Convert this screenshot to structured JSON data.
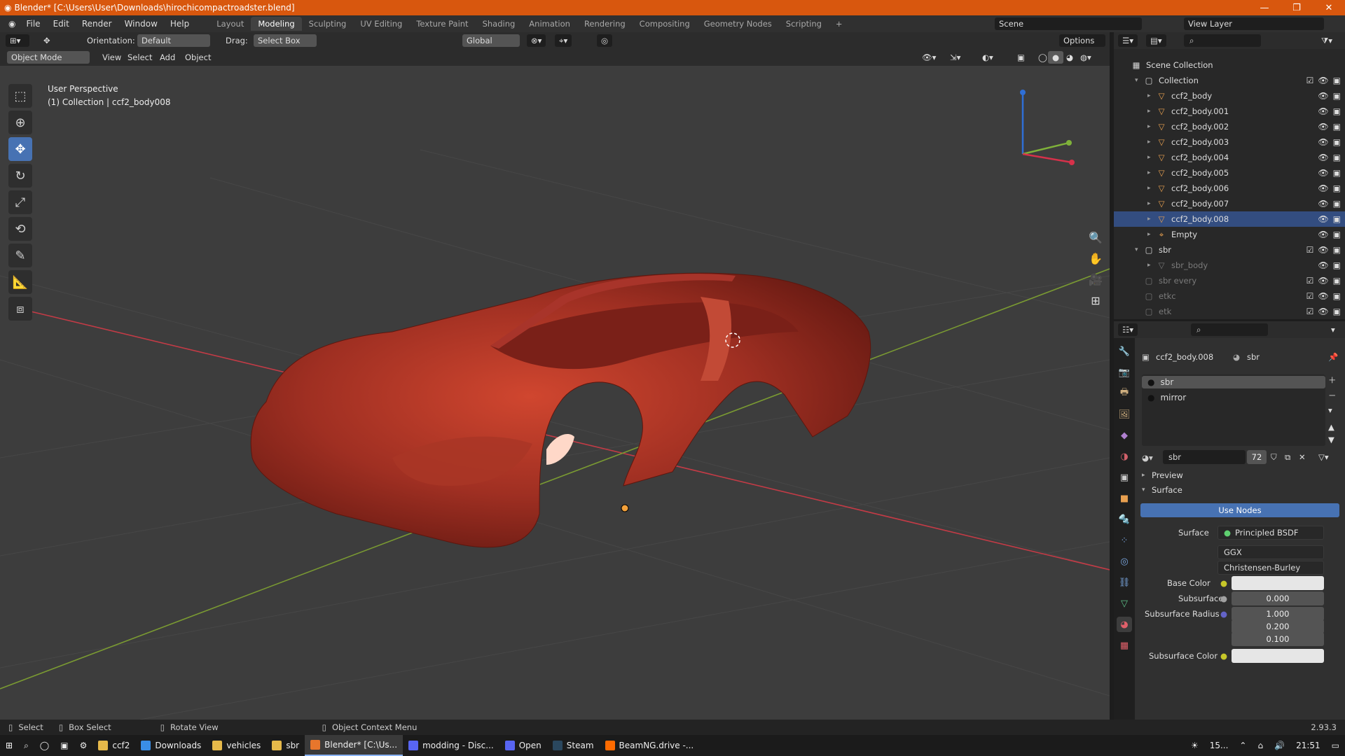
{
  "window": {
    "title": "Blender* [C:\\Users\\User\\Downloads\\hirochicompactroadster.blend]",
    "minimize": "—",
    "restore": "❐",
    "close": "✕"
  },
  "menu": {
    "items": [
      "File",
      "Edit",
      "Render",
      "Window",
      "Help"
    ]
  },
  "workspaces": {
    "tabs": [
      "Layout",
      "Modeling",
      "Sculpting",
      "UV Editing",
      "Texture Paint",
      "Shading",
      "Animation",
      "Rendering",
      "Compositing",
      "Geometry Nodes",
      "Scripting"
    ],
    "active": "Modeling",
    "add": "+"
  },
  "scene": {
    "name": "Scene",
    "view_layer": "View Layer"
  },
  "header": {
    "orientation_label": "Orientation:",
    "orientation_value": "Default",
    "drag_label": "Drag:",
    "drag_value": "Select Box",
    "transform_space": "Global",
    "options": "Options",
    "mode": "Object Mode",
    "menus": [
      "View",
      "Select",
      "Add",
      "Object"
    ]
  },
  "viewport": {
    "perspective": "User Perspective",
    "collection_info": "(1) Collection | ccf2_body008",
    "colors": {
      "bg": "#3d3d3d",
      "x_axis": "#c33b46",
      "y_axis": "#7a9a32",
      "body": "#b8382a"
    }
  },
  "outliner": {
    "search_placeholder": "",
    "root": "Scene Collection",
    "items": [
      {
        "label": "Collection",
        "type": "collection",
        "depth": 1,
        "expanded": true,
        "dim": false,
        "selected": false
      },
      {
        "label": "ccf2_body",
        "type": "mesh",
        "depth": 2,
        "dim": false,
        "selected": false
      },
      {
        "label": "ccf2_body.001",
        "type": "mesh",
        "depth": 2,
        "dim": false,
        "selected": false
      },
      {
        "label": "ccf2_body.002",
        "type": "mesh",
        "depth": 2,
        "dim": false,
        "selected": false
      },
      {
        "label": "ccf2_body.003",
        "type": "mesh",
        "depth": 2,
        "dim": false,
        "selected": false
      },
      {
        "label": "ccf2_body.004",
        "type": "mesh",
        "depth": 2,
        "dim": false,
        "selected": false
      },
      {
        "label": "ccf2_body.005",
        "type": "mesh",
        "depth": 2,
        "dim": false,
        "selected": false
      },
      {
        "label": "ccf2_body.006",
        "type": "mesh",
        "depth": 2,
        "dim": false,
        "selected": false
      },
      {
        "label": "ccf2_body.007",
        "type": "mesh",
        "depth": 2,
        "dim": false,
        "selected": false
      },
      {
        "label": "ccf2_body.008",
        "type": "mesh",
        "depth": 2,
        "dim": false,
        "selected": true
      },
      {
        "label": "Empty",
        "type": "empty",
        "depth": 2,
        "dim": false,
        "selected": false
      },
      {
        "label": "sbr",
        "type": "collection",
        "depth": 1,
        "expanded": true,
        "dim": false,
        "selected": false
      },
      {
        "label": "sbr_body",
        "type": "mesh",
        "depth": 2,
        "dim": true,
        "selected": false
      },
      {
        "label": "sbr every",
        "type": "collection",
        "depth": 1,
        "dim": true,
        "selected": false
      },
      {
        "label": "etkc",
        "type": "collection",
        "depth": 1,
        "dim": true,
        "selected": false
      },
      {
        "label": "etk",
        "type": "collection",
        "depth": 1,
        "dim": true,
        "selected": false
      }
    ]
  },
  "properties": {
    "breadcrumb_object": "ccf2_body.008",
    "breadcrumb_material": "sbr",
    "slots": [
      {
        "label": "sbr",
        "active": true
      },
      {
        "label": "mirror",
        "active": false
      }
    ],
    "material_name": "sbr",
    "user_count": "72",
    "preview_panel": "Preview",
    "surface_panel": "Surface",
    "use_nodes": "Use Nodes",
    "surface_label": "Surface",
    "surface_value": "Principled BSDF",
    "distribution": "GGX",
    "subsurface_method": "Christensen-Burley",
    "base_color_label": "Base Color",
    "subsurface_label": "Subsurface",
    "subsurface_value": "0.000",
    "subsurface_radius_label": "Subsurface Radius",
    "subsurface_radius": [
      "1.000",
      "0.200",
      "0.100"
    ],
    "subsurface_color_label": "Subsurface Color"
  },
  "status": {
    "select": "Select",
    "box_select": "Box Select",
    "rotate": "Rotate View",
    "context": "Object Context Menu",
    "version": "2.93.3"
  },
  "taskbar": {
    "items": [
      {
        "label": "ccf2",
        "color": "#e6b94a",
        "active": false
      },
      {
        "label": "Downloads",
        "color": "#3a8ee6",
        "active": false
      },
      {
        "label": "vehicles",
        "color": "#e6b94a",
        "active": false
      },
      {
        "label": "sbr",
        "color": "#e6b94a",
        "active": false
      },
      {
        "label": "Blender* [C:\\Us...",
        "color": "#e8762c",
        "active": true
      },
      {
        "label": "modding - Disc...",
        "color": "#5865f2",
        "active": false
      },
      {
        "label": "Open",
        "color": "#5865f2",
        "active": false
      },
      {
        "label": "Steam",
        "color": "#2a475e",
        "active": false
      },
      {
        "label": "BeamNG.drive -...",
        "color": "#ff6b00",
        "active": false
      }
    ],
    "temp": "15...",
    "clock": "21:51"
  }
}
